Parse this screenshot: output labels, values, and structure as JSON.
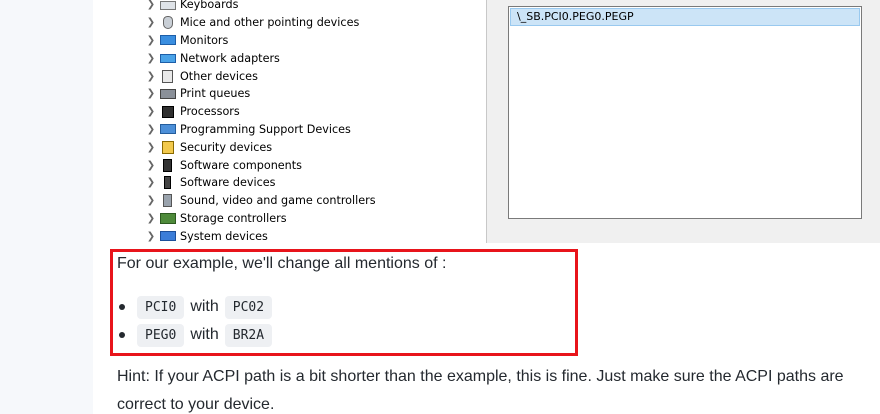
{
  "device_tree": {
    "items": [
      {
        "label": "Keyboards",
        "icon": "keyboard-icon"
      },
      {
        "label": "Mice and other pointing devices",
        "icon": "mouse-icon"
      },
      {
        "label": "Monitors",
        "icon": "monitor-icon"
      },
      {
        "label": "Network adapters",
        "icon": "network-adapter-icon"
      },
      {
        "label": "Other devices",
        "icon": "unknown-device-icon"
      },
      {
        "label": "Print queues",
        "icon": "printer-icon"
      },
      {
        "label": "Processors",
        "icon": "processor-icon"
      },
      {
        "label": "Programming Support Devices",
        "icon": "programming-device-icon"
      },
      {
        "label": "Security devices",
        "icon": "security-device-icon"
      },
      {
        "label": "Software components",
        "icon": "software-component-icon"
      },
      {
        "label": "Software devices",
        "icon": "software-device-icon"
      },
      {
        "label": "Sound, video and game controllers",
        "icon": "speaker-icon"
      },
      {
        "label": "Storage controllers",
        "icon": "storage-controller-icon"
      },
      {
        "label": "System devices",
        "icon": "system-device-icon"
      }
    ]
  },
  "properties": {
    "value": "\\_SB.PCI0.PEG0.PEGP"
  },
  "article": {
    "intro": "For our example, we'll change all mentions of :",
    "bullets": [
      {
        "from": "PCI0",
        "with": "with",
        "to": "PC02"
      },
      {
        "from": "PEG0",
        "with": "with",
        "to": "BR2A"
      }
    ],
    "hint": "Hint: If your ACPI path is a bit shorter than the example, this is fine. Just make sure the ACPI paths are correct to your device."
  },
  "colors": {
    "highlight_border": "#e8141b",
    "selection": "#cce4f7"
  }
}
